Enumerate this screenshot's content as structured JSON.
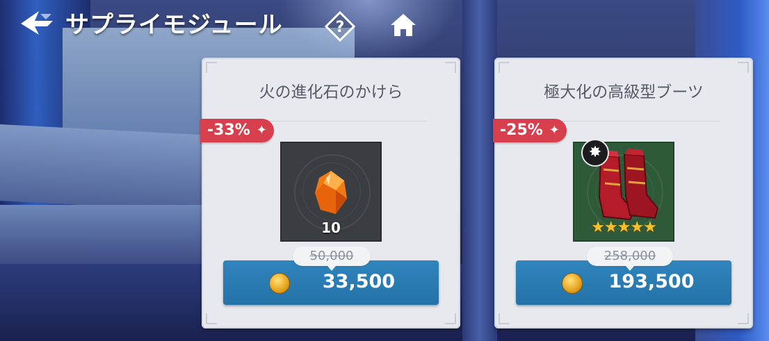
{
  "header": {
    "title": "サプライモジュール",
    "back_icon": "back-arrow-icon",
    "help_icon": "help-icon",
    "home_icon": "home-icon"
  },
  "cards": [
    {
      "name": "火の進化石のかけら",
      "discount": "-33%",
      "quantity": "10",
      "original_price": "50,000",
      "price": "33,500",
      "icon": "orange-crystal-icon",
      "currency_icon": "gold-coin-icon"
    },
    {
      "name": "極大化の高級型ブーツ",
      "discount": "-25%",
      "original_price": "258,000",
      "price": "193,500",
      "icon": "red-boots-icon",
      "stars": 5,
      "currency_icon": "gold-coin-icon"
    }
  ],
  "colors": {
    "discount": "#d83f4c",
    "buy_button": "#2a7cb3",
    "card": "#e7e9ef"
  }
}
